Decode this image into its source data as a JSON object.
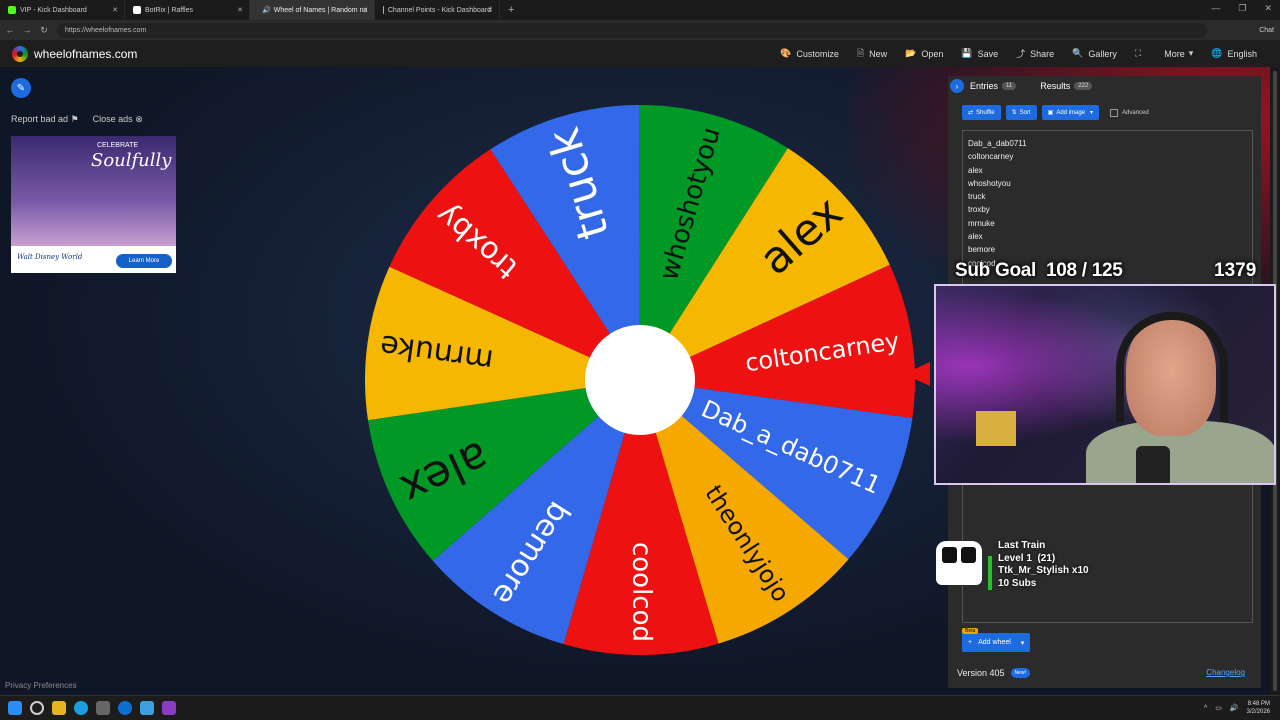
{
  "browser": {
    "tabs": [
      {
        "label": "VIP - Kick Dashboard",
        "color": "#53fc18"
      },
      {
        "label": "BotRix | Raffles",
        "color": "#ffffff"
      },
      {
        "label": "Wheel of Names | Random na",
        "color": "#3369e8"
      },
      {
        "label": "Channel Points - Kick Dashboard",
        "color": "#53fc18"
      }
    ],
    "url": "https://wheelofnames.com",
    "chat_label": "Chat"
  },
  "site": {
    "logo": "wheelofnames.com",
    "menu": [
      {
        "label": "Customize",
        "icon": "palette-icon"
      },
      {
        "label": "New",
        "icon": "new-file-icon"
      },
      {
        "label": "Open",
        "icon": "folder-icon"
      },
      {
        "label": "Save",
        "icon": "save-icon"
      },
      {
        "label": "Share",
        "icon": "share-icon"
      },
      {
        "label": "Gallery",
        "icon": "search-icon"
      },
      {
        "label": "",
        "icon": "fullscreen-icon"
      },
      {
        "label": "More",
        "icon": "chevron-down-icon"
      },
      {
        "label": "English",
        "icon": "globe-icon"
      }
    ]
  },
  "ads": {
    "report": "Report bad ad",
    "close": "Close ads",
    "celebrate": "CELEBRATE",
    "soulfully": "Soulfully",
    "brand": "Walt Disney World",
    "cta": "Learn More"
  },
  "privacy": "Privacy Preferences",
  "wheel": {
    "segments": [
      {
        "name": "coltoncarney",
        "color": "#ee1111"
      },
      {
        "name": "Dab_a_dab0711",
        "color": "#3369e8"
      },
      {
        "name": "theonlyjojo",
        "color": "#f5a800"
      },
      {
        "name": "coolcod",
        "color": "#ee1111"
      },
      {
        "name": "bemore",
        "color": "#3369e8"
      },
      {
        "name": "alex",
        "color": "#009925"
      },
      {
        "name": "mrnuke",
        "color": "#f5b700"
      },
      {
        "name": "troxby",
        "color": "#ee1111"
      },
      {
        "name": "truck",
        "color": "#3369e8"
      },
      {
        "name": "whoshotyou",
        "color": "#009925"
      },
      {
        "name": "alex",
        "color": "#f5b700"
      }
    ]
  },
  "panel": {
    "entries_label": "Entries",
    "entries_count": "11",
    "results_label": "Results",
    "results_count": "222",
    "shuffle": "Shuffle",
    "sort": "Sort",
    "add_image": "Add image",
    "advanced": "Advanced",
    "entries": [
      "Dab_a_dab0711",
      "coltoncarney",
      "alex",
      "whoshotyou",
      "truck",
      "troxby",
      "mrnuke",
      "alex",
      "bemore",
      "coolcod"
    ],
    "beta": "Beta",
    "add_wheel": "Add wheel",
    "version": "Version 405",
    "new_badge": "New!",
    "changelog": "Changelog"
  },
  "overlay": {
    "sub_goal": "Sub Goal  108 / 125",
    "sub_count": "1379",
    "train_title": "Last Train",
    "train_level": "Level 1  (21)",
    "train_user": "Ttk_Mr_Stylish x10",
    "train_subs": "10 Subs"
  },
  "taskbar": {
    "time": "8:48 PM",
    "date": "3/2/2026"
  }
}
